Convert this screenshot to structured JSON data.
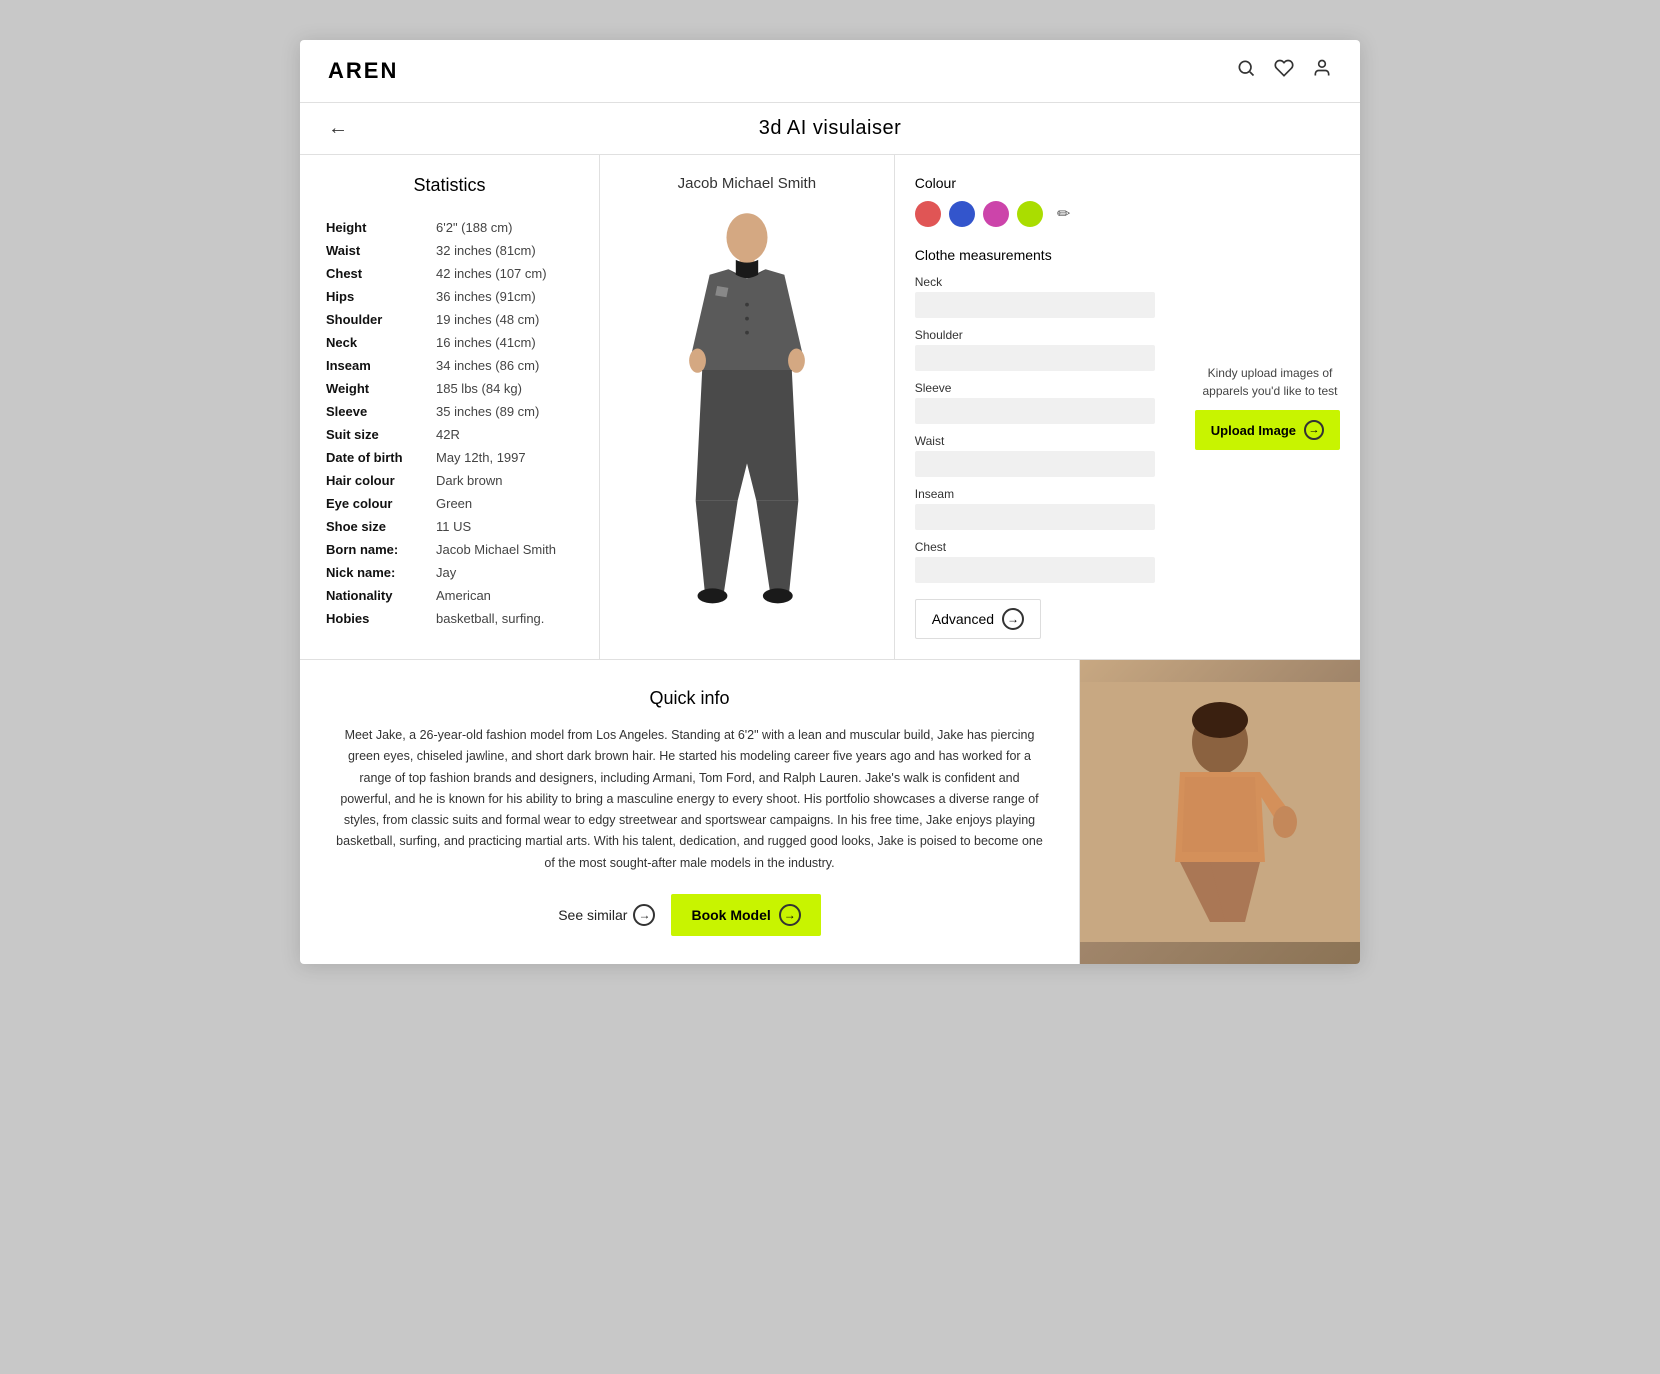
{
  "header": {
    "logo": "AREN",
    "icons": [
      "search",
      "heart",
      "user"
    ]
  },
  "title_bar": {
    "back_label": "←",
    "page_title": "3d AI visulaiser"
  },
  "statistics": {
    "title": "Statistics",
    "fields": [
      {
        "label": "Height",
        "value": "6'2\" (188 cm)"
      },
      {
        "label": "Waist",
        "value": "32 inches (81cm)"
      },
      {
        "label": "Chest",
        "value": "42 inches (107 cm)"
      },
      {
        "label": "Hips",
        "value": "36 inches (91cm)"
      },
      {
        "label": "Shoulder",
        "value": "19 inches (48 cm)"
      },
      {
        "label": "Neck",
        "value": "16 inches (41cm)"
      },
      {
        "label": "Inseam",
        "value": "34 inches (86 cm)"
      },
      {
        "label": "Weight",
        "value": "185 lbs (84 kg)"
      },
      {
        "label": "Sleeve",
        "value": "35 inches (89 cm)"
      },
      {
        "label": "Suit size",
        "value": "42R"
      },
      {
        "label": "Date of birth",
        "value": "May 12th, 1997"
      },
      {
        "label": "Hair colour",
        "value": "Dark brown"
      },
      {
        "label": "Eye colour",
        "value": "Green"
      },
      {
        "label": "Shoe size",
        "value": "11 US"
      },
      {
        "label": "Born name:",
        "value": "Jacob Michael Smith"
      },
      {
        "label": "Nick name:",
        "value": "Jay"
      },
      {
        "label": "Nationality",
        "value": "American"
      },
      {
        "label": "Hobies",
        "value": "basketball, surfing."
      }
    ]
  },
  "model": {
    "name": "Jacob Michael Smith"
  },
  "colour_panel": {
    "label": "Colour",
    "swatches": [
      {
        "color": "#e05555",
        "name": "red"
      },
      {
        "color": "#3355cc",
        "name": "blue"
      },
      {
        "color": "#cc44aa",
        "name": "pink"
      },
      {
        "color": "#aadd00",
        "name": "lime"
      }
    ],
    "picker_icon": "✏"
  },
  "measurements_panel": {
    "label": "Clothe measurements",
    "fields": [
      {
        "label": "Neck",
        "placeholder": ""
      },
      {
        "label": "Shoulder",
        "placeholder": ""
      },
      {
        "label": "Sleeve",
        "placeholder": ""
      },
      {
        "label": "Waist",
        "placeholder": ""
      },
      {
        "label": "Inseam",
        "placeholder": ""
      },
      {
        "label": "Chest",
        "placeholder": ""
      }
    ],
    "advanced_label": "Advanced"
  },
  "upload": {
    "hint": "Kindy upload images of apparels you'd like to test",
    "button_label": "Upload Image"
  },
  "quick_info": {
    "title": "Quick info",
    "body": "Meet Jake, a 26-year-old fashion model from Los Angeles. Standing at 6'2\" with a lean and muscular build, Jake has piercing green eyes, chiseled jawline, and short dark brown hair. He started his modeling career five years ago and has worked for a range of top fashion brands and designers, including Armani, Tom Ford, and Ralph Lauren. Jake's walk is confident and powerful, and he is known for his ability to bring a masculine energy to every shoot. His portfolio showcases a diverse range of styles, from classic suits and formal wear to edgy streetwear and sportswear campaigns. In his free time, Jake enjoys playing basketball, surfing, and practicing martial arts. With his talent, dedication, and rugged good looks, Jake is poised to become one of the most sought-after male models in the industry.",
    "see_similar_label": "See similar",
    "book_model_label": "Book Model"
  }
}
